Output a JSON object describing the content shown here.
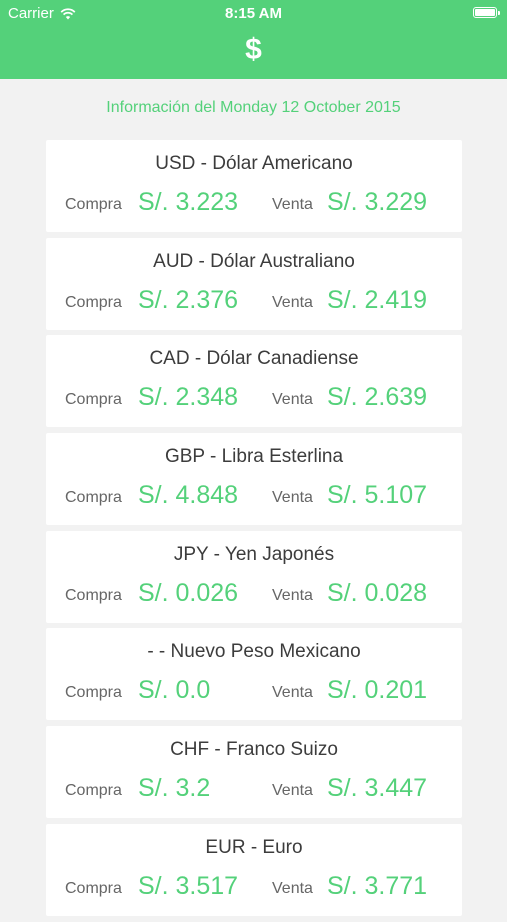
{
  "status_bar": {
    "carrier": "Carrier",
    "time": "8:15 AM",
    "icons": [
      "wifi-icon",
      "battery-icon"
    ]
  },
  "header": {
    "icon_glyph": "$",
    "accent_color": "#54d17a"
  },
  "info": {
    "text": "Información del Monday 12 October 2015"
  },
  "labels": {
    "buy": "Compra",
    "sell": "Venta"
  },
  "currencies": [
    {
      "name": "USD - Dólar Americano",
      "buy": "S/. 3.223",
      "sell": "S/. 3.229"
    },
    {
      "name": "AUD - Dólar Australiano",
      "buy": "S/. 2.376",
      "sell": "S/. 2.419"
    },
    {
      "name": "CAD - Dólar Canadiense",
      "buy": "S/. 2.348",
      "sell": "S/. 2.639"
    },
    {
      "name": "GBP - Libra Esterlina",
      "buy": "S/. 4.848",
      "sell": "S/. 5.107"
    },
    {
      "name": "JPY - Yen Japonés",
      "buy": "S/. 0.026",
      "sell": "S/. 0.028"
    },
    {
      "name": "- - Nuevo Peso Mexicano",
      "buy": "S/. 0.0",
      "sell": "S/. 0.201"
    },
    {
      "name": "CHF - Franco Suizo",
      "buy": "S/. 3.2",
      "sell": "S/. 3.447"
    },
    {
      "name": "EUR - Euro",
      "buy": "S/. 3.517",
      "sell": "S/. 3.771"
    }
  ]
}
